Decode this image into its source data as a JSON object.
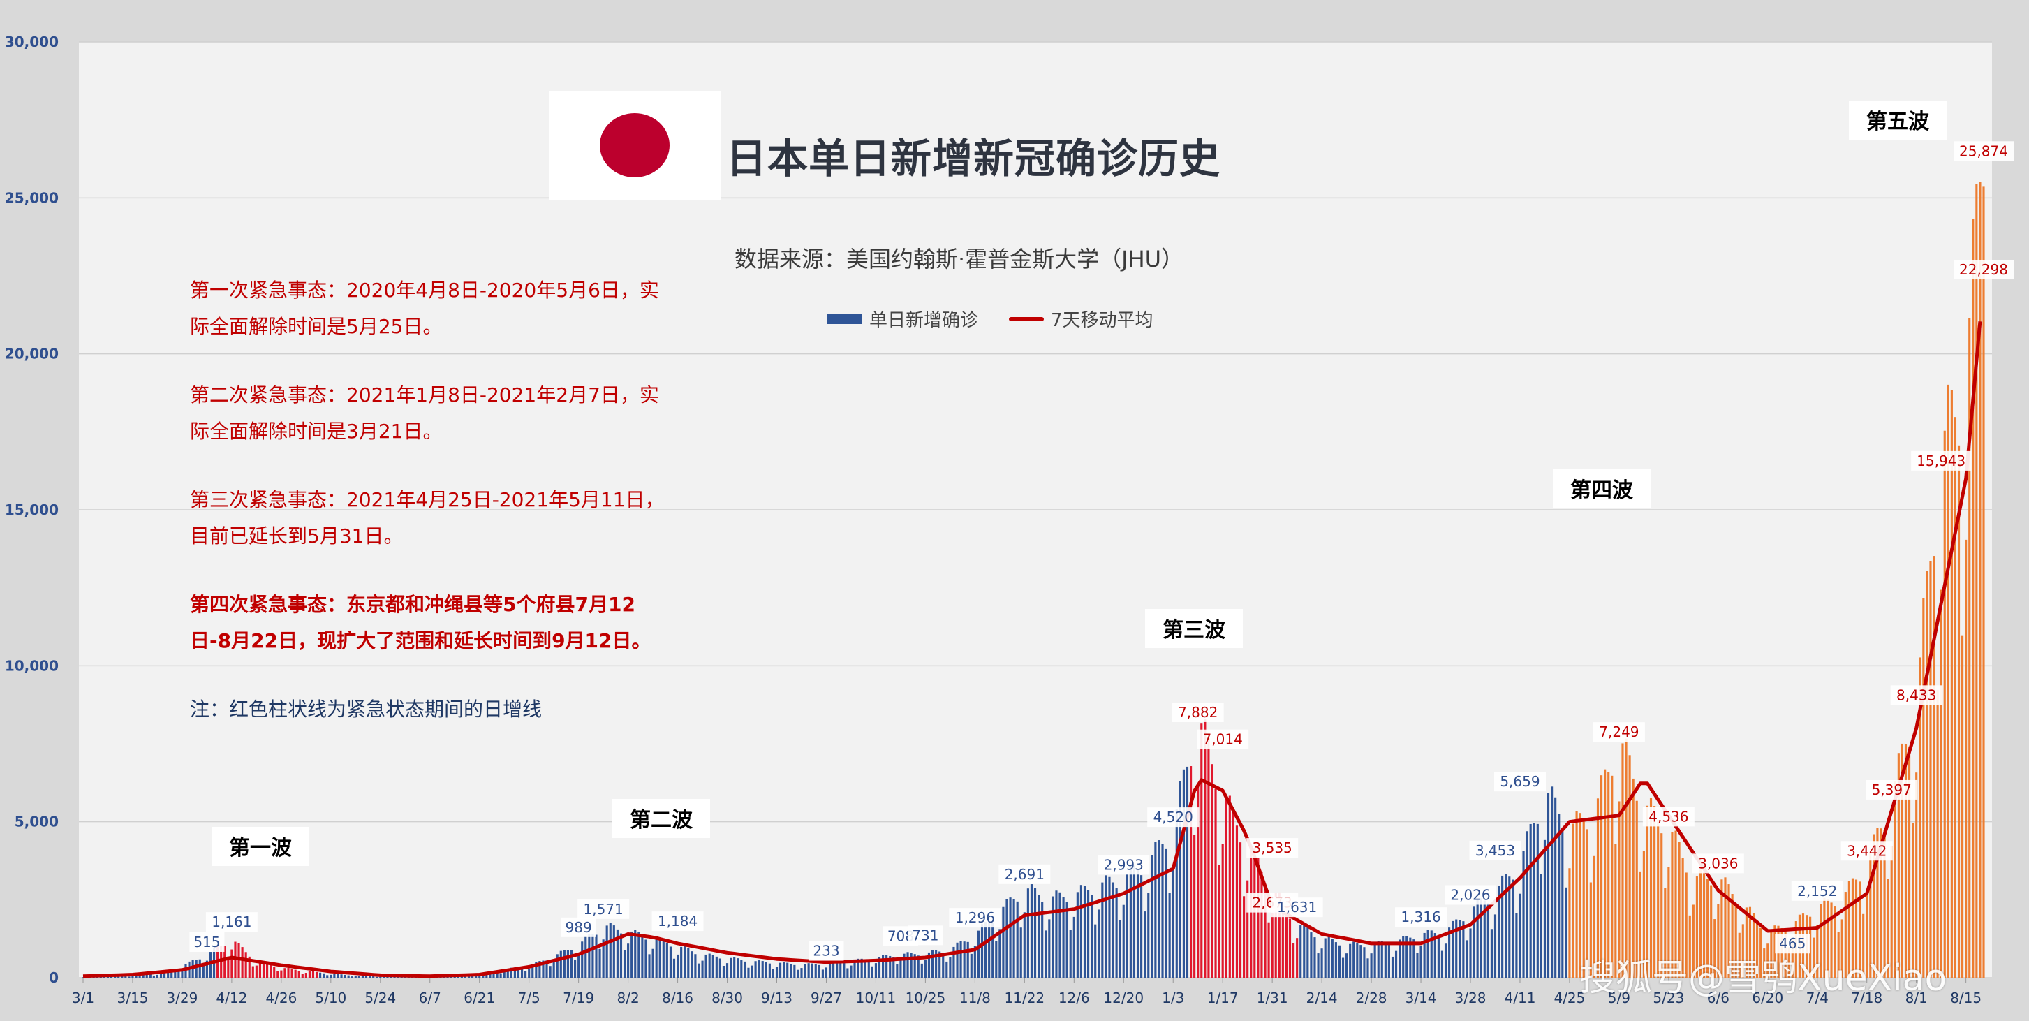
{
  "header": {
    "title": "日本单日新增新冠确诊历史",
    "source": "数据来源：美国约翰斯·霍普金斯大学（JHU）",
    "watermark": "搜狐号@雪鸮XueXiao"
  },
  "legend": {
    "bars_label": "单日新增确诊",
    "line_label": "7天移动平均"
  },
  "notes": [
    {
      "text": "第一次紧急事态：2020年4月8日-2020年5月6日，实际全面解除时间是5月25日。",
      "bold": false
    },
    {
      "text": "第二次紧急事态：2021年1月8日-2021年2月7日，实际全面解除时间是3月21日。",
      "bold": false
    },
    {
      "text": "第三次紧急事态：2021年4月25日-2021年5月11日，目前已延长到5月31日。",
      "bold": false
    },
    {
      "text": "第四次紧急事态：东京都和冲绳县等5个府县7月12日-8月22日，现扩大了范围和延长时间到9月12日。",
      "bold": true
    }
  ],
  "footnote": "注：红色柱状线为紧急状态期间的日增线",
  "colors": {
    "bar_normal": "#2f5597",
    "bar_emergency": "#e0182d",
    "bar_fourth_wave": "#ed7d31",
    "line": "#c00000",
    "plot_bg": "#f2f2f2",
    "flag_red": "#bc002d"
  },
  "chart_data": {
    "type": "bar",
    "title": "日本单日新增新冠确诊历史",
    "ylim": [
      0,
      30000
    ],
    "yticks": [
      "0",
      "5,000",
      "10,000",
      "15,000",
      "20,000",
      "25,000",
      "30,000"
    ],
    "xticks": [
      "3/1",
      "3/15",
      "3/29",
      "4/12",
      "4/26",
      "5/10",
      "5/24",
      "6/7",
      "6/21",
      "7/5",
      "7/19",
      "8/2",
      "8/16",
      "8/30",
      "9/13",
      "9/27",
      "10/11",
      "10/25",
      "11/8",
      "11/22",
      "12/6",
      "12/20",
      "1/3",
      "1/17",
      "1/31",
      "2/14",
      "2/28",
      "3/14",
      "3/28",
      "4/11",
      "4/25",
      "5/9",
      "5/23",
      "6/6",
      "6/20",
      "7/4",
      "7/18",
      "8/1",
      "8/15"
    ],
    "grid": true,
    "legend_position": "top-center",
    "series": [
      {
        "name": "单日新增确诊",
        "kind": "bar",
        "note": "weekly samples of daily new cases (estimated)",
        "x": [
          "3/1",
          "3/8",
          "3/15",
          "3/22",
          "3/29",
          "4/5",
          "4/12",
          "4/19",
          "4/26",
          "5/3",
          "5/10",
          "5/17",
          "5/24",
          "5/31",
          "6/7",
          "6/14",
          "6/21",
          "6/28",
          "7/5",
          "7/12",
          "7/19",
          "7/26",
          "8/2",
          "8/9",
          "8/16",
          "8/23",
          "8/30",
          "9/6",
          "9/13",
          "9/20",
          "9/27",
          "10/4",
          "10/11",
          "10/18",
          "10/25",
          "11/1",
          "11/8",
          "11/15",
          "11/22",
          "11/29",
          "12/6",
          "12/13",
          "12/20",
          "12/27",
          "1/3",
          "1/10",
          "1/17",
          "1/24",
          "1/31",
          "2/7",
          "2/14",
          "2/21",
          "2/28",
          "3/7",
          "3/14",
          "3/21",
          "3/28",
          "4/4",
          "4/11",
          "4/18",
          "4/25",
          "5/2",
          "5/9",
          "5/16",
          "5/23",
          "5/30",
          "6/6",
          "6/13",
          "6/20",
          "6/27",
          "7/4",
          "7/11",
          "7/18",
          "7/25",
          "8/1",
          "8/8",
          "8/15",
          "8/20"
        ],
        "values": [
          20,
          40,
          60,
          120,
          350,
          700,
          1161,
          500,
          300,
          200,
          120,
          60,
          40,
          30,
          40,
          60,
          120,
          250,
          350,
          650,
          989,
          1571,
          1400,
          1184,
          950,
          700,
          600,
          500,
          450,
          400,
          420,
          500,
          600,
          708,
          731,
          850,
          1296,
          2000,
          2691,
          2400,
          2500,
          2800,
          2993,
          3500,
          4520,
          7882,
          5500,
          4000,
          2673,
          1631,
          1200,
          1000,
          1000,
          1100,
          1316,
          1400,
          2026,
          2600,
          3453,
          5659,
          4500,
          5000,
          7249,
          5200,
          4536,
          3000,
          3036,
          2200,
          1400,
          1600,
          2152,
          2400,
          3442,
          5397,
          8433,
          15943,
          18000,
          25874
        ]
      },
      {
        "name": "7天移动平均",
        "kind": "line",
        "note": "estimated",
        "x": [
          "3/1",
          "3/15",
          "3/29",
          "4/12",
          "4/26",
          "5/10",
          "5/24",
          "6/7",
          "6/21",
          "7/5",
          "7/19",
          "8/2",
          "8/9",
          "8/16",
          "8/30",
          "9/13",
          "9/27",
          "10/11",
          "10/25",
          "11/8",
          "11/22",
          "12/6",
          "12/20",
          "1/3",
          "1/10",
          "1/17",
          "1/24",
          "1/31",
          "2/14",
          "2/28",
          "3/14",
          "3/28",
          "4/11",
          "4/25",
          "5/9",
          "5/16",
          "5/23",
          "6/6",
          "6/20",
          "7/4",
          "7/18",
          "8/1",
          "8/15",
          "8/20"
        ],
        "values": [
          50,
          100,
          250,
          650,
          400,
          200,
          80,
          50,
          100,
          350,
          750,
          1400,
          1300,
          1100,
          800,
          600,
          500,
          550,
          650,
          900,
          2000,
          2200,
          2700,
          3500,
          6400,
          6000,
          4500,
          2300,
          1400,
          1100,
          1100,
          1700,
          3200,
          5000,
          5200,
          6400,
          5200,
          2800,
          1500,
          1600,
          2700,
          8000,
          16000,
          22298
        ]
      }
    ],
    "annotations": [
      {
        "label": "515",
        "x": "4/5",
        "value": 515
      },
      {
        "label": "1,161",
        "x": "4/12",
        "value": 1161
      },
      {
        "label": "989",
        "x": "7/19",
        "value": 989
      },
      {
        "label": "1,571",
        "x": "7/26",
        "value": 1571
      },
      {
        "label": "1,184",
        "x": "8/16",
        "value": 1184
      },
      {
        "label": "233",
        "x": "9/27",
        "value": 233
      },
      {
        "label": "708",
        "x": "10/18",
        "value": 708
      },
      {
        "label": "731",
        "x": "10/25",
        "value": 731
      },
      {
        "label": "1,296",
        "x": "11/8",
        "value": 1296
      },
      {
        "label": "2,691",
        "x": "11/22",
        "value": 2691
      },
      {
        "label": "2,993",
        "x": "12/20",
        "value": 2993
      },
      {
        "label": "4,520",
        "x": "1/3",
        "value": 4520
      },
      {
        "label": "7,882",
        "x": "1/10",
        "value": 7882
      },
      {
        "label": "7,014",
        "x": "1/17",
        "value": 7014
      },
      {
        "label": "3,535",
        "x": "1/31",
        "value": 3535
      },
      {
        "label": "2,673",
        "x": "1/31",
        "value": 2673
      },
      {
        "label": "1,631",
        "x": "2/7",
        "value": 1631
      },
      {
        "label": "1,316",
        "x": "3/14",
        "value": 1316
      },
      {
        "label": "2,026",
        "x": "3/28",
        "value": 2026
      },
      {
        "label": "3,453",
        "x": "4/4",
        "value": 3453
      },
      {
        "label": "5,659",
        "x": "4/11",
        "value": 5659
      },
      {
        "label": "7,249",
        "x": "5/9",
        "value": 7249
      },
      {
        "label": "4,536",
        "x": "5/23",
        "value": 4536
      },
      {
        "label": "3,036",
        "x": "6/6",
        "value": 3036
      },
      {
        "label": "465",
        "x": "6/27",
        "value": 465
      },
      {
        "label": "2,152",
        "x": "7/4",
        "value": 2152
      },
      {
        "label": "3,442",
        "x": "7/18",
        "value": 3442
      },
      {
        "label": "5,397",
        "x": "7/25",
        "value": 5397
      },
      {
        "label": "8,433",
        "x": "8/1",
        "value": 8433
      },
      {
        "label": "15,943",
        "x": "8/8",
        "value": 15943
      },
      {
        "label": "22,298",
        "x": "8/20",
        "value": 22298
      },
      {
        "label": "25,874",
        "x": "8/20",
        "value": 25874
      }
    ],
    "waves": [
      {
        "label": "第一波"
      },
      {
        "label": "第二波"
      },
      {
        "label": "第三波"
      },
      {
        "label": "第四波"
      },
      {
        "label": "第五波"
      }
    ]
  }
}
